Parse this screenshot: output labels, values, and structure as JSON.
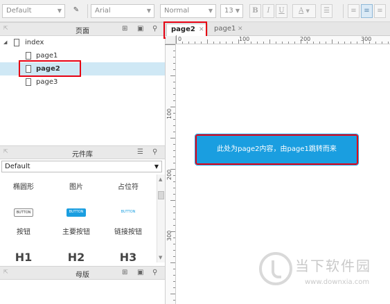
{
  "toolbar": {
    "style_select": "Default",
    "font_select": "Arial",
    "weight_select": "Normal",
    "size_select": "13",
    "bold": "B",
    "italic": "I",
    "underline": "U",
    "font_color": "A"
  },
  "pages_panel": {
    "title": "页面",
    "root": "index",
    "pages": [
      "page1",
      "page2",
      "page3"
    ],
    "selected": "page2"
  },
  "widgets_panel": {
    "title": "元件库",
    "library": "Default",
    "row1": [
      "椭圆形",
      "图片",
      "占位符"
    ],
    "button_samples": [
      "BUTTON",
      "BUTTON",
      "BUTTON"
    ],
    "row2": [
      "按钮",
      "主要按钮",
      "链接按钮"
    ],
    "headings": [
      "H1",
      "H2",
      "H3"
    ]
  },
  "masters_panel": {
    "title": "母版"
  },
  "tabs": [
    {
      "label": "page2",
      "active": true
    },
    {
      "label": "page1",
      "active": false
    }
  ],
  "ruler": {
    "h_labels": [
      "0",
      "100",
      "200",
      "300"
    ],
    "v_labels": [
      "100",
      "200",
      "300"
    ]
  },
  "canvas": {
    "box_text": "此处为page2内容，由page1跳转而来"
  },
  "watermark": {
    "text": "当下软件园",
    "url": "www.downxia.com"
  },
  "colors": {
    "accent_blue": "#1a9ee0",
    "highlight_red": "#e60012",
    "selected_row": "#cfe8f5"
  }
}
